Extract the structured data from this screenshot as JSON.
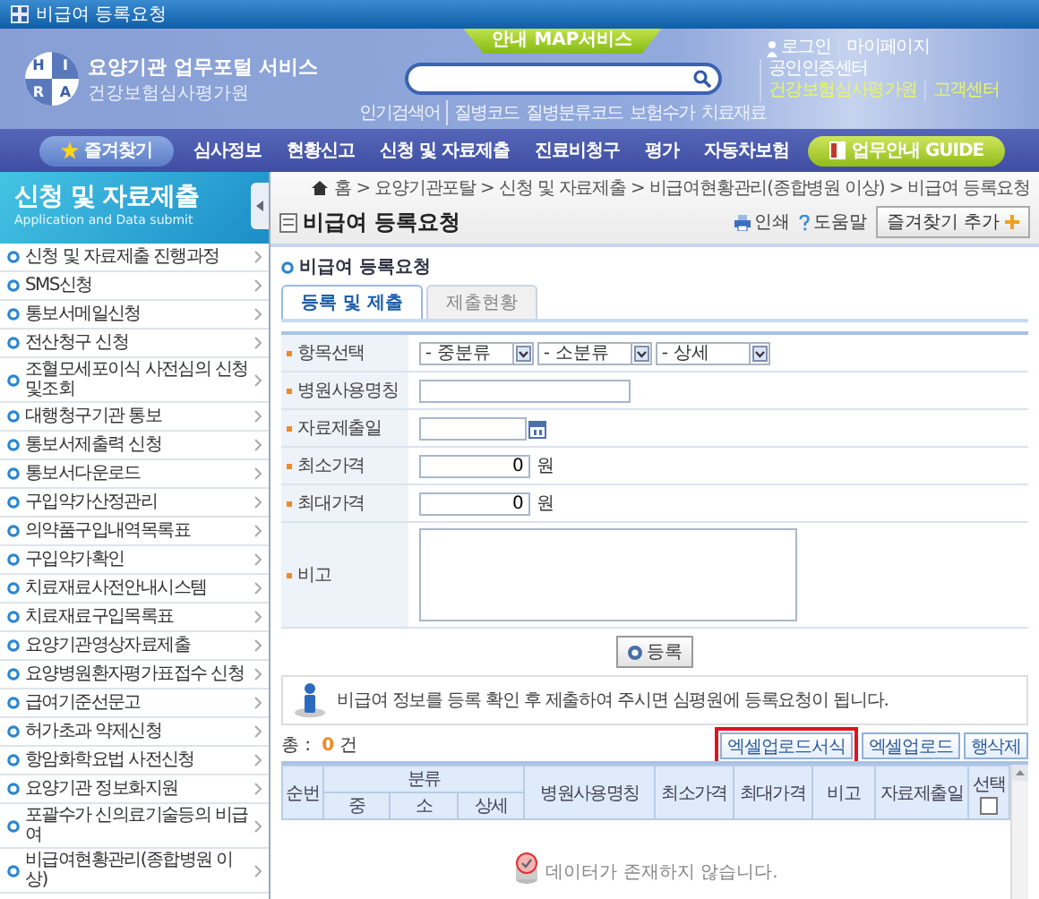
{
  "window": {
    "title": "비급여 등록요청"
  },
  "header": {
    "logo_letters": [
      "H",
      "I",
      "R",
      "A"
    ],
    "service_name": "요양기관 업무포털 서비스",
    "org_name": "건강보험심사평가원",
    "map_tab": "안내 MAP서비스",
    "top_links": [
      {
        "label": "로그인",
        "kind": "login"
      },
      {
        "label": "마이페이지",
        "kind": "plain"
      },
      {
        "label": "공인인증센터",
        "kind": "plain"
      },
      {
        "label": "건강보험심사평가원",
        "kind": "accent"
      },
      {
        "label": "고객센터",
        "kind": "accent"
      }
    ],
    "popular_label": "인기검색어",
    "search_links": [
      "질병코드",
      "질병분류코드",
      "보험수가",
      "치료재료"
    ]
  },
  "nav": {
    "items": [
      {
        "label": "즐겨찾기",
        "kind": "favorite"
      },
      {
        "label": "심사정보",
        "kind": "plain"
      },
      {
        "label": "현황신고",
        "kind": "plain"
      },
      {
        "label": "신청 및 자료제출",
        "kind": "plain"
      },
      {
        "label": "진료비청구",
        "kind": "plain"
      },
      {
        "label": "평가",
        "kind": "plain"
      },
      {
        "label": "자동차보험",
        "kind": "plain"
      },
      {
        "label": "업무안내 GUIDE",
        "kind": "guide"
      }
    ]
  },
  "sidebar": {
    "title": "신청 및 자료제출",
    "subtitle": "Application and Data submit",
    "items": [
      {
        "label": "신청 및 자료제출 진행과정"
      },
      {
        "label": "SMS신청"
      },
      {
        "label": "통보서메일신청"
      },
      {
        "label": "전산청구 신청"
      },
      {
        "label": "조혈모세포이식 사전심의 신청및조회"
      },
      {
        "label": "대행청구기관 통보"
      },
      {
        "label": "통보서제출력 신청"
      },
      {
        "label": "통보서다운로드"
      },
      {
        "label": "구입약가산정관리"
      },
      {
        "label": "의약품구입내역목록표"
      },
      {
        "label": "구입약가확인"
      },
      {
        "label": "치료재료사전안내시스템"
      },
      {
        "label": "치료재료구입목록표"
      },
      {
        "label": "요양기관영상자료제출"
      },
      {
        "label": "요양병원환자평가표접수 신청"
      },
      {
        "label": "급여기준선문고"
      },
      {
        "label": "허가초과 약제신청"
      },
      {
        "label": "항암화학요법 사전신청"
      },
      {
        "label": "요양기관 정보화지원"
      },
      {
        "label": "포괄수가 신의료기술등의 비급여"
      },
      {
        "label": "비급여현황관리(종합병원 이상)"
      }
    ]
  },
  "page": {
    "breadcrumb": "홈 > 요양기관포탈 > 신청 및 자료제출 > 비급여현황관리(종합병원 이상) > 비급여 등록요청",
    "title": "비급여 등록요청",
    "tools": [
      {
        "label": "인쇄",
        "kind": "print"
      },
      {
        "label": "도움말",
        "kind": "help"
      }
    ],
    "favorite_button": "즐겨찾기 추가",
    "section_title": "비급여 등록요청"
  },
  "tabs": [
    {
      "label": "등록 및 제출",
      "selected": true
    },
    {
      "label": "제출현황",
      "selected": false
    }
  ],
  "form": {
    "rows": [
      {
        "label": "항목선택",
        "kind": "selects",
        "selects": [
          "- 중분류",
          "- 소분류",
          "- 상세"
        ]
      },
      {
        "label": "병원사용명칭",
        "kind": "text"
      },
      {
        "label": "자료제출일",
        "kind": "date"
      },
      {
        "label": "최소가격",
        "kind": "price",
        "value": "0",
        "unit": "원"
      },
      {
        "label": "최대가격",
        "kind": "price",
        "value": "0",
        "unit": "원"
      },
      {
        "label": "비고",
        "kind": "textarea"
      }
    ]
  },
  "register_button": "등록",
  "notice": "비급여 정보를 등록 확인 후 제출하여 주시면 심평원에 등록요청이 됩니다.",
  "count": {
    "label": "총 :",
    "value": "0",
    "unit": "건"
  },
  "table_buttons": [
    {
      "label": "엑셀업로드서식",
      "highlighted": true
    },
    {
      "label": "엑셀업로드",
      "highlighted": false
    },
    {
      "label": "행삭제",
      "highlighted": false
    }
  ],
  "table": {
    "columns": [
      {
        "label": "순번"
      },
      {
        "label": "분류",
        "children": [
          "중",
          "소",
          "상세"
        ]
      },
      {
        "label": "병원사용명칭"
      },
      {
        "label": "최소가격"
      },
      {
        "label": "최대가격"
      },
      {
        "label": "비고"
      },
      {
        "label": "자료제출일"
      },
      {
        "label": "선택"
      }
    ],
    "select_all_checked": false,
    "empty_message": "데이터가 존재하지 않습니다."
  }
}
